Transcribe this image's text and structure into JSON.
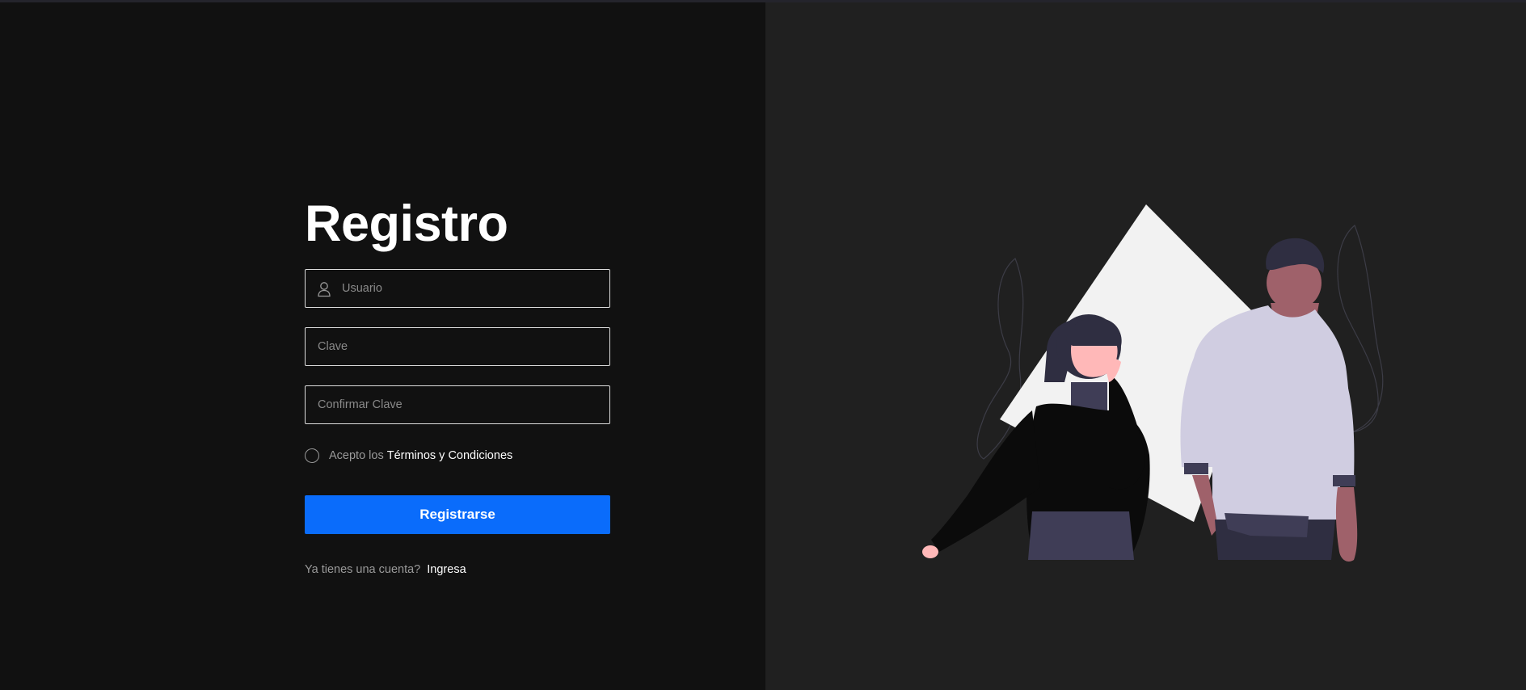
{
  "form": {
    "title": "Registro",
    "username_placeholder": "Usuario",
    "password_placeholder": "Clave",
    "confirm_placeholder": "Confirmar Clave",
    "terms_prefix": "Acepto los",
    "terms_link": "Términos y Condiciones",
    "submit_label": "Registrarse",
    "login_prompt": "Ya tienes una cuenta?",
    "login_link": "Ingresa"
  },
  "icons": {
    "username": "user-icon",
    "illustration": "two-people-illustration"
  },
  "colors": {
    "left_background": "#111111",
    "right_background": "#202020",
    "primary_button": "#0a6cfb",
    "text_white": "#ffffff",
    "text_muted": "#9a9a9a"
  }
}
